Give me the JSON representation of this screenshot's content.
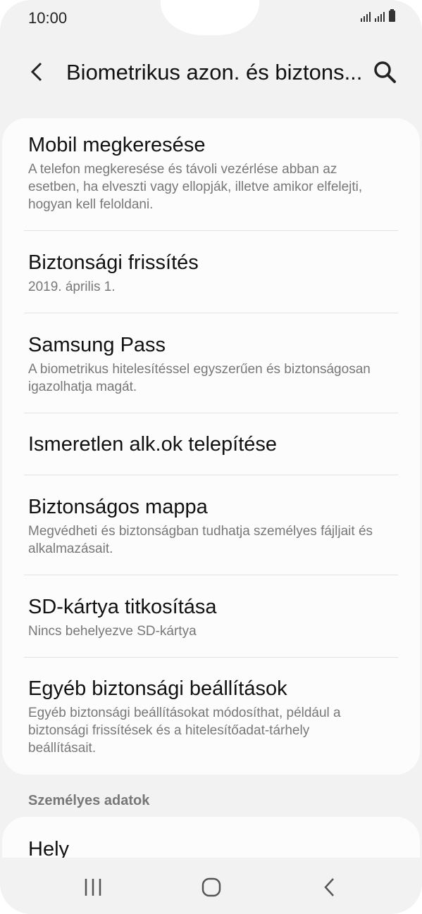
{
  "status_bar": {
    "time": "10:00"
  },
  "app_bar": {
    "title": "Biometrikus azon. és biztons..."
  },
  "items": [
    {
      "title": "Mobil megkeresése",
      "subtitle": "A telefon megkeresése és távoli vezérlése abban az esetben, ha elveszti vagy ellopják, illetve amikor elfelejti, hogyan kell feloldani."
    },
    {
      "title": "Biztonsági frissítés",
      "subtitle": "2019. április 1."
    },
    {
      "title": "Samsung Pass",
      "subtitle": "A biometrikus hitelesítéssel egyszerűen és biztonságosan igazolhatja magát."
    },
    {
      "title": "Ismeretlen alk.ok telepítése",
      "subtitle": ""
    },
    {
      "title": "Biztonságos mappa",
      "subtitle": "Megvédheti és biztonságban tudhatja személyes fájljait és alkalmazásait."
    },
    {
      "title": "SD-kártya titkosítása",
      "subtitle": "Nincs behelyezve SD-kártya"
    },
    {
      "title": "Egyéb biztonsági beállítások",
      "subtitle": "Egyéb biztonsági beállításokat módosíthat, például a biztonsági frissítések és a hitelesítőadat-tárhely beállításait."
    }
  ],
  "section": {
    "header": "Személyes adatok",
    "first_item": "Hely"
  },
  "icons": {
    "back": "back-arrow-icon",
    "search": "search-icon",
    "recents": "recents-icon",
    "home": "home-icon",
    "nav_back": "nav-back-icon"
  },
  "colors": {
    "background": "#f2f2f2",
    "card": "#fcfcfc",
    "subtitle": "#787878"
  }
}
